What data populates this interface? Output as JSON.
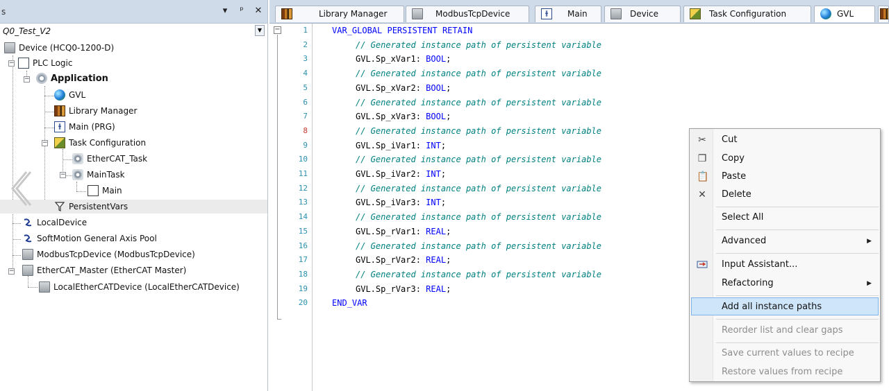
{
  "left_panel": {
    "title": "s",
    "project": "Q0_Test_V2",
    "tree": [
      {
        "label": "Device (HCQ0-1200-D)"
      },
      {
        "label": "PLC Logic"
      },
      {
        "label": "Application"
      },
      {
        "label": "GVL"
      },
      {
        "label": "Library Manager"
      },
      {
        "label": "Main (PRG)"
      },
      {
        "label": "Task Configuration"
      },
      {
        "label": "EtherCAT_Task"
      },
      {
        "label": "MainTask"
      },
      {
        "label": "Main"
      },
      {
        "label": "PersistentVars"
      },
      {
        "label": "LocalDevice"
      },
      {
        "label": "SoftMotion General Axis Pool"
      },
      {
        "label": "ModbusTcpDevice (ModbusTcpDevice)"
      },
      {
        "label": "EtherCAT_Master (EtherCAT Master)"
      },
      {
        "label": "LocalEtherCATDevice (LocalEtherCATDevice)"
      }
    ]
  },
  "tabs": [
    {
      "label": "Library Manager"
    },
    {
      "label": "ModbusTcpDevice"
    },
    {
      "label": "Main"
    },
    {
      "label": "Device"
    },
    {
      "label": "Task Configuration"
    },
    {
      "label": "GVL"
    }
  ],
  "editor": {
    "lines": [
      {
        "n": "1",
        "text": "VAR_GLOBAL PERSISTENT RETAIN",
        "kind": "keyword"
      },
      {
        "n": "2",
        "text": "// Generated instance path of persistent variable",
        "kind": "comment"
      },
      {
        "n": "3",
        "ident": "GVL.Sp_xVar1: ",
        "type": "BOOL",
        "kind": "decl"
      },
      {
        "n": "4",
        "text": "// Generated instance path of persistent variable",
        "kind": "comment"
      },
      {
        "n": "5",
        "ident": "GVL.Sp_xVar2: ",
        "type": "BOOL",
        "kind": "decl"
      },
      {
        "n": "6",
        "text": "// Generated instance path of persistent variable",
        "kind": "comment"
      },
      {
        "n": "7",
        "ident": "GVL.Sp_xVar3: ",
        "type": "BOOL",
        "kind": "decl"
      },
      {
        "n": "8",
        "text": "// Generated instance path of persistent variable",
        "kind": "comment"
      },
      {
        "n": "9",
        "ident": "GVL.Sp_iVar1: ",
        "type": "INT",
        "kind": "decl"
      },
      {
        "n": "10",
        "text": "// Generated instance path of persistent variable",
        "kind": "comment"
      },
      {
        "n": "11",
        "ident": "GVL.Sp_iVar2: ",
        "type": "INT",
        "kind": "decl"
      },
      {
        "n": "12",
        "text": "// Generated instance path of persistent variable",
        "kind": "comment"
      },
      {
        "n": "13",
        "ident": "GVL.Sp_iVar3: ",
        "type": "INT",
        "kind": "decl"
      },
      {
        "n": "14",
        "text": "// Generated instance path of persistent variable",
        "kind": "comment"
      },
      {
        "n": "15",
        "ident": "GVL.Sp_rVar1: ",
        "type": "REAL",
        "kind": "decl"
      },
      {
        "n": "16",
        "text": "// Generated instance path of persistent variable",
        "kind": "comment"
      },
      {
        "n": "17",
        "ident": "GVL.Sp_rVar2: ",
        "type": "REAL",
        "kind": "decl"
      },
      {
        "n": "18",
        "text": "// Generated instance path of persistent variable",
        "kind": "comment"
      },
      {
        "n": "19",
        "ident": "GVL.Sp_rVar3: ",
        "type": "REAL",
        "kind": "decl"
      },
      {
        "n": "20",
        "text": "END_VAR",
        "kind": "keyword"
      }
    ]
  },
  "context_menu": {
    "items": [
      {
        "label": "Cut",
        "icon": "scissors-icon"
      },
      {
        "label": "Copy",
        "icon": "copy-icon"
      },
      {
        "label": "Paste",
        "icon": "paste-icon"
      },
      {
        "label": "Delete",
        "icon": "delete-icon"
      },
      {
        "label": "Select All"
      },
      {
        "label": "Advanced",
        "submenu": true
      },
      {
        "label": "Input Assistant...",
        "icon": "input-assistant-icon"
      },
      {
        "label": "Refactoring",
        "submenu": true
      },
      {
        "label": "Add all instance paths",
        "highlighted": true
      },
      {
        "label": "Reorder list and clear gaps",
        "disabled": true
      },
      {
        "label": "Save current values to recipe",
        "disabled": true
      },
      {
        "label": "Restore values from recipe",
        "disabled": true
      }
    ]
  },
  "colors": {
    "keyword": "#0000ff",
    "comment": "#008080",
    "line_number": "#2b91af",
    "menu_highlight": "#cfe5fa"
  }
}
